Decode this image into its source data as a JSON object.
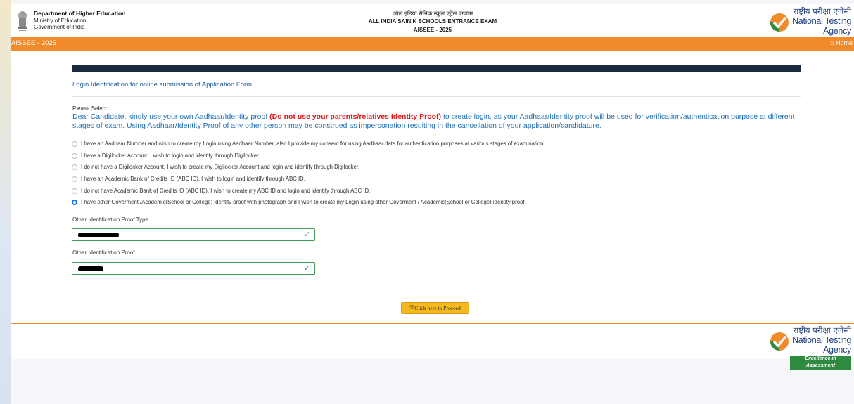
{
  "header": {
    "dept_line1": "Department of Higher Education",
    "dept_line2": "Ministry of Education",
    "dept_line3": "Government of India",
    "title_hindi": "ऑल इंडिया सैनिक स्कूल एंट्रेंस एग्जाम",
    "title_english": "ALL INDIA SAINIK SCHOOLS ENTRANCE EXAM",
    "title_year": "AISSEE - 2025"
  },
  "nta": {
    "hindi": "राष्ट्रीय परीक्षा एजेंसी",
    "english": "National Testing Agency",
    "tagline": "Excellence in Assessment",
    "icon": "check-logo-icon"
  },
  "nav": {
    "brand": "AISSEE - 2025",
    "home": "⌂ Home"
  },
  "form": {
    "title": "Login Identification for online submission of Application Form",
    "please_select": "Please Select:",
    "notice_part1": "Dear Candidate, kindly use your own Aadhaar/Identity proof ",
    "notice_red": "(Do not use your parents/relatives Identity Proof)",
    "notice_part2": " to create login, as your Aadhaar/Identity proof will be used for verification/authentication purpose at different stages of exam. Using Aadhaar/Identity Proof of any other person may be construed as impersonation resulting in the cancellation of your application/candidature.",
    "options": [
      "I have an Aadhaar Number and wish to create my Login using Aadhaar Number, also I provide my consent for using Aadhaar data for authentication purposes at various stages of examination.",
      "I have a Digilocker Account. I wish to login and identify through Digilocker.",
      "I do not have a Digilocker Account. I wish to create my Digilocker Account and login and identify through Digilocker.",
      "I have an Academic Bank of Credits ID (ABC ID). I wish to login and identify through ABC ID.",
      "I do not have Academic Bank of Credits ID (ABC ID). I wish to create my ABC ID and login and identify through ABC ID.",
      "I have other Goverment /Academic(School or College) identity proof with photograph and I wish to create my Login using other Goverment / Academic(School or College) identity proof."
    ],
    "selected_option_index": 5,
    "proof_type_label": "Other Identification Proof Type",
    "proof_label": "Other Identification Proof",
    "proceed_label": "Click here to Proceed",
    "valid_color": "#2e9a48"
  },
  "colors": {
    "nav_orange": "#f08a2a",
    "band_navy": "#1b2940",
    "title_blue": "#1f5fa0",
    "notice_red": "#e0191a",
    "button_yellow": "#f6b81e",
    "nta_green": "#2e8a3e"
  }
}
